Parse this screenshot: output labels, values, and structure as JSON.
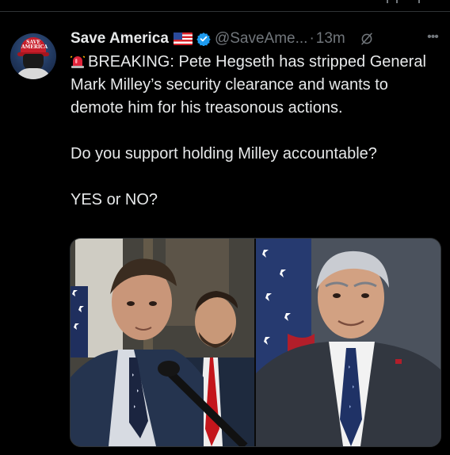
{
  "tweet": {
    "author_name": "Save America",
    "author_handle": "@SaveAme...",
    "separator": "·",
    "time": "13m",
    "avatar_hat_text": "SAVE AMERICA",
    "text_line1": "BREAKING: Pete Hegseth has stripped General Mark Milley’s security clearance and wants to demote him for his treasonous actions.",
    "text_line2": "Do you support holding Milley accountable?",
    "text_line3": "YES or NO?"
  },
  "icons": {
    "flag": "us-flag-icon",
    "verified": "verified-badge-icon",
    "grok": "grok-icon",
    "more": "more-options-icon",
    "siren": "siren-emoji-icon"
  },
  "colors": {
    "background": "#000000",
    "text": "#e7e9ea",
    "muted": "#71767b",
    "verified": "#1d9bf0",
    "border": "#2f3336"
  }
}
